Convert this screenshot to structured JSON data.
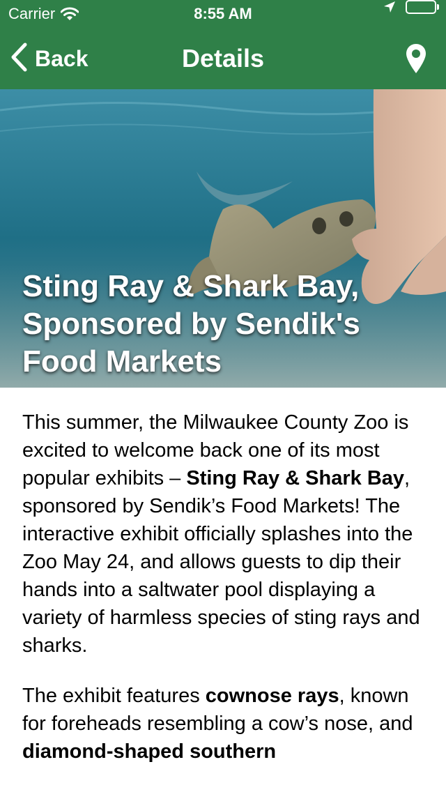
{
  "status_bar": {
    "carrier": "Carrier",
    "time": "8:55 AM"
  },
  "nav": {
    "back_label": "Back",
    "title": "Details"
  },
  "hero": {
    "title": "Sting Ray & Shark Bay, Sponsored by Sendik's Food Markets"
  },
  "article": {
    "p1": {
      "t1": "This summer, the Milwaukee County Zoo is excited to welcome back one of its most popular exhibits – ",
      "b1": "Sting Ray & Shark Bay",
      "t2": ", sponsored by Sendik’s Food Markets! The interactive exhibit officially splashes into the Zoo May 24, and allows guests to dip their hands into a saltwater pool displaying a variety of harmless species of sting rays and sharks."
    },
    "p2": {
      "t1": "The exhibit features ",
      "b1": "cownose rays",
      "t2": ", known for foreheads resembling a cow’s nose, and ",
      "b2": "diamond-shaped southern"
    }
  },
  "colors": {
    "nav_green": "#2f8048",
    "water": "#1f6f86"
  },
  "icons": [
    "back-chevron-icon",
    "wifi-icon",
    "location-arrow-icon",
    "battery-icon",
    "map-pin-icon"
  ]
}
